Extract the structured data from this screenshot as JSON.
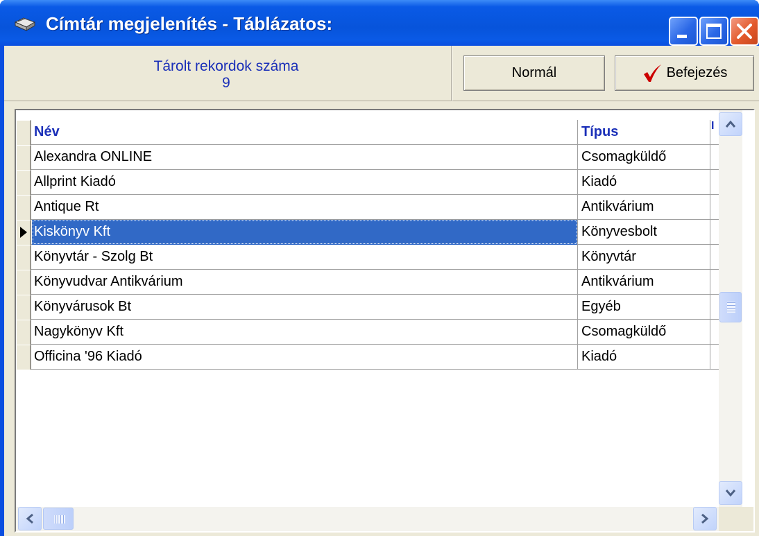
{
  "window": {
    "title": "Címtár megjelenítés - Táblázatos:",
    "icon": "books-icon",
    "controls": [
      "minimize-icon",
      "maximize-icon",
      "close-icon"
    ]
  },
  "header": {
    "records_label": "Tárolt rekordok száma",
    "records_count": "9",
    "normal_label": "Normál",
    "finish_label": "Befejezés",
    "finish_icon": "checkmark-icon"
  },
  "grid": {
    "columns": [
      "Név",
      "Típus",
      "I"
    ],
    "rows": [
      {
        "name": "Alexandra ONLINE",
        "type": "Csomagküldő"
      },
      {
        "name": "Allprint Kiadó",
        "type": "Kiadó"
      },
      {
        "name": "Antique Rt",
        "type": "Antikvárium"
      },
      {
        "name": "Kiskönyv Kft",
        "type": "Könyvesbolt"
      },
      {
        "name": "Könyvtár - Szolg Bt",
        "type": "Könyvtár"
      },
      {
        "name": "Könyvudvar Antikvárium",
        "type": "Antikvárium"
      },
      {
        "name": "Könyvárusok Bt",
        "type": "Egyéb"
      },
      {
        "name": "Nagykönyv Kft",
        "type": "Csomagküldő"
      },
      {
        "name": "Officina '96 Kiadó",
        "type": "Kiadó"
      }
    ],
    "selected_row": 4
  },
  "colors": {
    "title_bar": "#0a5ae6",
    "header_text": "#1a2fb8",
    "selection": "#3169c6",
    "face": "#ece9d8",
    "check": "#cc0000"
  }
}
